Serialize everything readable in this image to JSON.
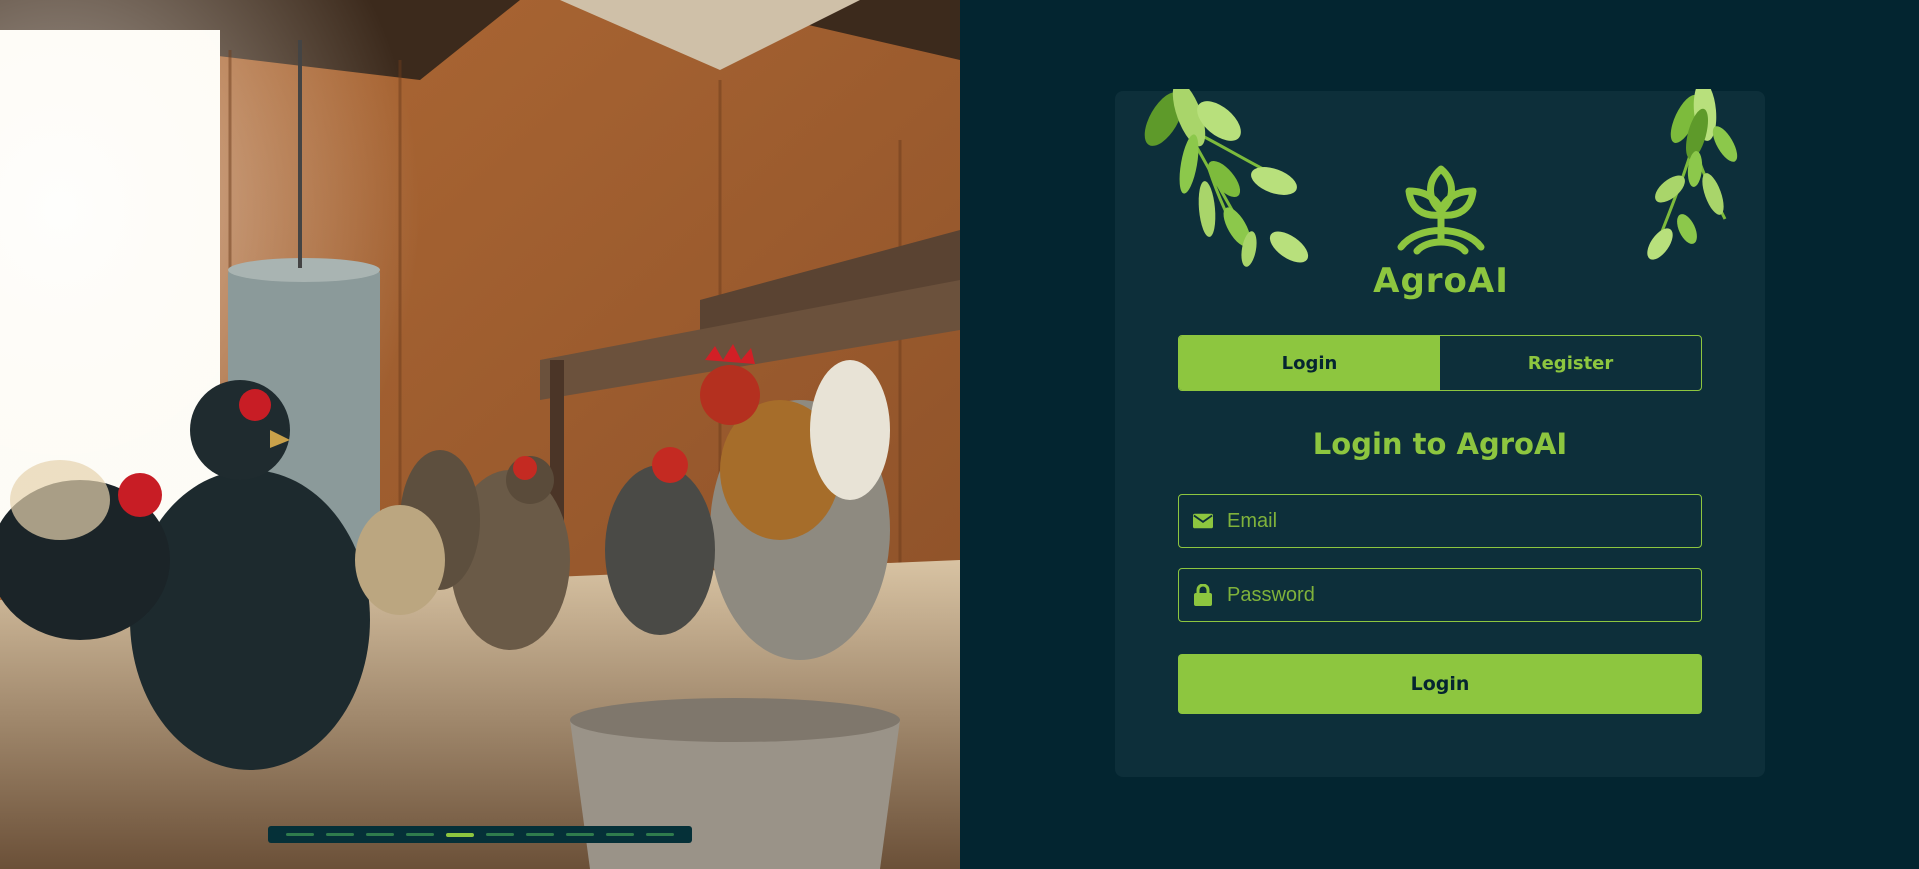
{
  "brand": {
    "name": "AgroAI"
  },
  "auth_tabs": [
    {
      "label": "Login",
      "active": true
    },
    {
      "label": "Register",
      "active": false
    }
  ],
  "form": {
    "heading": "Login to AgroAI",
    "email_placeholder": "Email",
    "password_placeholder": "Password",
    "submit_label": "Login",
    "email_icon": "envelope-icon",
    "password_icon": "lock-icon"
  },
  "carousel": {
    "slide_count": 10,
    "active_index": 4
  },
  "colors": {
    "accent": "#8dc63f",
    "background": "#032530",
    "card": "#0d2f3a"
  }
}
